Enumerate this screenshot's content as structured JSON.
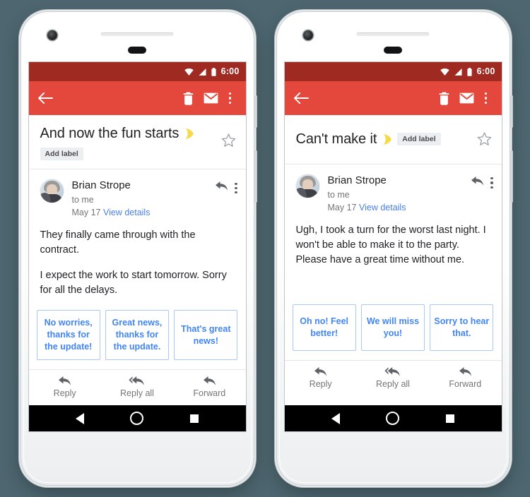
{
  "background_color": "#4d666f",
  "colors": {
    "statusbar": "#9e2a22",
    "toolbar": "#e4483c",
    "smart_reply_text": "#4285f4",
    "smart_reply_border": "#a8c7fa",
    "link": "#4a80e8",
    "moon_emoji": "#f7d94c"
  },
  "phones": [
    {
      "status_bar": {
        "time": "6:00",
        "icons": [
          "wifi-icon",
          "signal-icon",
          "battery-icon"
        ]
      },
      "toolbar": {
        "back_label": "Back",
        "actions": [
          "delete-icon",
          "mark-unread-icon",
          "more-options-icon"
        ]
      },
      "subject": "And now the fun starts",
      "subject_emoji": "🌙",
      "label_chip": "Add label",
      "label_chip_inline": false,
      "starred": false,
      "sender": {
        "name": "Brian Strope",
        "recipient": "to me",
        "date": "May 17",
        "details_link": "View details"
      },
      "message_paragraphs": [
        "They finally came through with the contract.",
        "I expect the work to start tomorrow. Sorry for all the delays."
      ],
      "smart_replies": [
        "No worries, thanks for the update!",
        "Great news, thanks for the update.",
        "That's great news!"
      ],
      "reply_actions": [
        {
          "label": "Reply",
          "icon": "reply-icon"
        },
        {
          "label": "Reply all",
          "icon": "reply-all-icon"
        },
        {
          "label": "Forward",
          "icon": "forward-icon"
        }
      ],
      "nav_bar": [
        "back-nav-icon",
        "home-nav-icon",
        "recents-nav-icon"
      ]
    },
    {
      "status_bar": {
        "time": "6:00",
        "icons": [
          "wifi-icon",
          "signal-icon",
          "battery-icon"
        ]
      },
      "toolbar": {
        "back_label": "Back",
        "actions": [
          "delete-icon",
          "mark-unread-icon",
          "more-options-icon"
        ]
      },
      "subject": "Can't make it",
      "subject_emoji": "🌙",
      "label_chip": "Add label",
      "label_chip_inline": true,
      "starred": false,
      "sender": {
        "name": "Brian Strope",
        "recipient": "to me",
        "date": "May 17",
        "details_link": "View details"
      },
      "message_paragraphs": [
        "Ugh, I took a turn for the worst last night. I won't be able to make it to the party. Please have a great time without me."
      ],
      "smart_replies": [
        "Oh no! Feel better!",
        "We will miss you!",
        "Sorry to hear that."
      ],
      "reply_actions": [
        {
          "label": "Reply",
          "icon": "reply-icon"
        },
        {
          "label": "Reply all",
          "icon": "reply-all-icon"
        },
        {
          "label": "Forward",
          "icon": "forward-icon"
        }
      ],
      "nav_bar": [
        "back-nav-icon",
        "home-nav-icon",
        "recents-nav-icon"
      ]
    }
  ]
}
